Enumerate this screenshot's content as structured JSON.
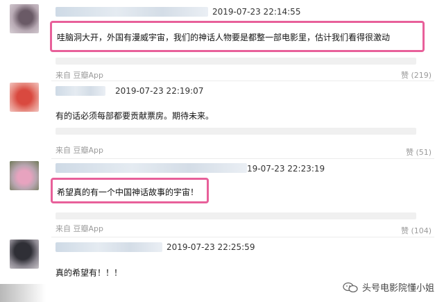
{
  "comments": [
    {
      "time": "2019-07-23 22:14:55",
      "text": "哇脑洞大开，外国有漫威宇宙，我们的神话人物要是都整一部电影里，估计我们看得很激动",
      "source": "来自 豆瓣App",
      "like": "赞 (219)"
    },
    {
      "time": "2019-07-23 22:19:07",
      "text": "有的话必须每部都要贡献票房。期待未来。",
      "source": "来自 豆瓣App",
      "like": "赞 (51)"
    },
    {
      "time": "19-07-23 22:23:19",
      "text": "希望真的有一个中国神话故事的宇宙！",
      "source": "来自 豆瓣App",
      "like": "赞 (104)"
    },
    {
      "time": "2019-07-23 22:25:59",
      "text": "真的希望有！！！"
    }
  ],
  "watermark": "头号电影院懂小姐"
}
